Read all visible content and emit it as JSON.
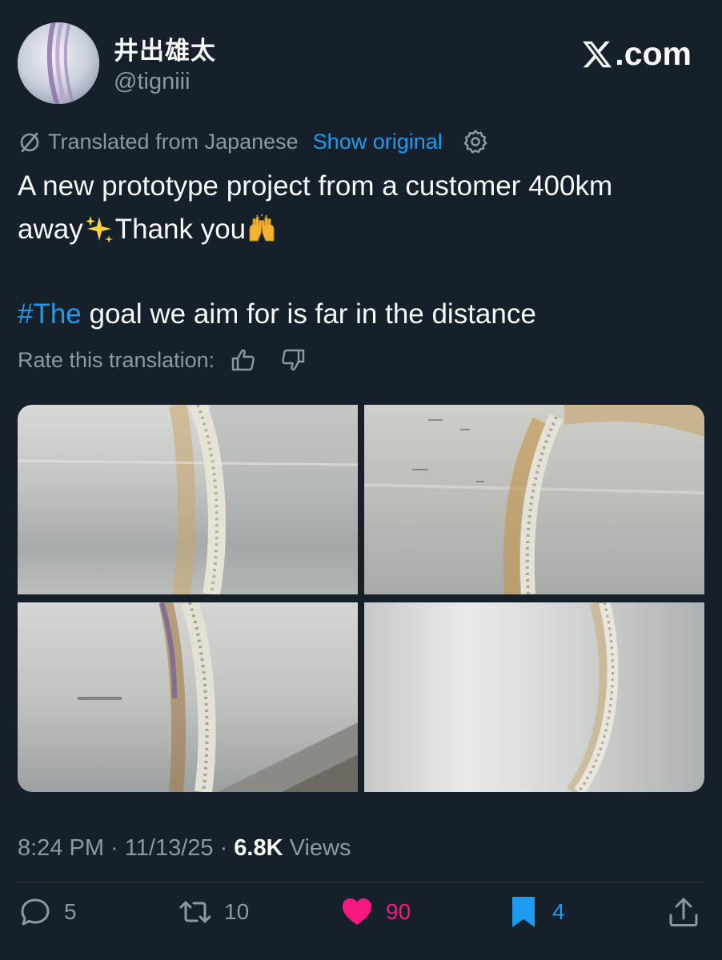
{
  "author": {
    "display_name": "井出雄太",
    "handle": "@tigniii"
  },
  "brand": {
    "site_text": ".com",
    "icon": "x-logo-icon"
  },
  "translation": {
    "label": "Translated from Japanese",
    "show_original": "Show original",
    "settings_icon": "gear-icon",
    "rate_label": "Rate this translation:"
  },
  "tweet": {
    "line1": "A new prototype project from a customer 400km",
    "line2_a": "away",
    "line2_b": "Thank you",
    "emoji_1": "sparkles-icon",
    "emoji_2": "raising-hands-icon",
    "hashtag": "#The",
    "hashtag_rest": " goal we aim for is far in the distance"
  },
  "media": {
    "count": 4,
    "photos": [
      "weld-photo-1",
      "weld-photo-2",
      "weld-photo-3",
      "weld-photo-4"
    ]
  },
  "meta": {
    "time": "8:24 PM",
    "separator": " · ",
    "date": "11/13/25",
    "views_count": "6.8K",
    "views_label": " Views"
  },
  "actions": {
    "replies": "5",
    "retweets": "10",
    "likes": "90",
    "bookmarks": "4"
  },
  "colors": {
    "background": "#15202b",
    "accent": "#1d9bf0",
    "like": "#f91880",
    "muted": "#8b98a5"
  }
}
